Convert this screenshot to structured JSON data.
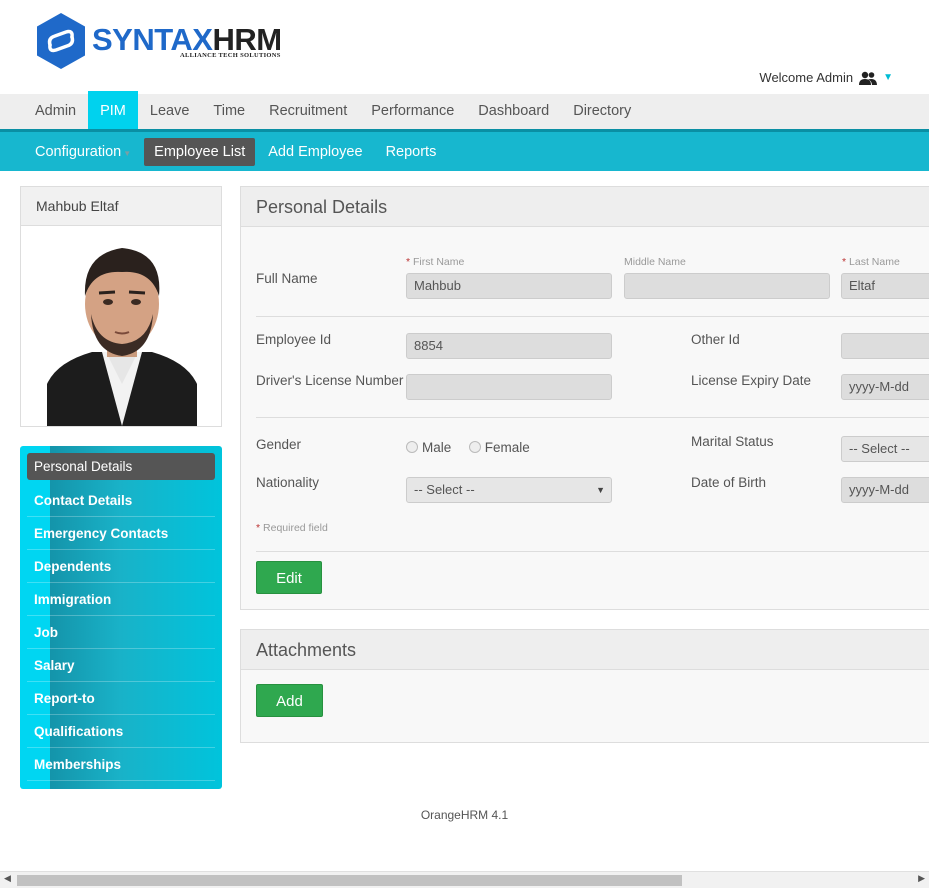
{
  "brand": {
    "syntax": "SYNTAX",
    "hrm": "HRM",
    "tagline": "ALLIANCE TECH SOLUTIONS",
    "hex_color": "#1f69c9"
  },
  "header": {
    "welcome": "Welcome Admin"
  },
  "topnav": [
    "Admin",
    "PIM",
    "Leave",
    "Time",
    "Recruitment",
    "Performance",
    "Dashboard",
    "Directory"
  ],
  "subnav": {
    "configuration": "Configuration",
    "employee_list": "Employee List",
    "add_employee": "Add Employee",
    "reports": "Reports"
  },
  "profile": {
    "name": "Mahbub Eltaf"
  },
  "sidemenu": [
    "Personal Details",
    "Contact Details",
    "Emergency Contacts",
    "Dependents",
    "Immigration",
    "Job",
    "Salary",
    "Report-to",
    "Qualifications",
    "Memberships"
  ],
  "personal": {
    "title": "Personal Details",
    "full_name_label": "Full Name",
    "first_name_label": "First Name",
    "middle_name_label": "Middle Name",
    "last_name_label": "Last Name",
    "req_star": "*",
    "first_name": "Mahbub",
    "middle_name": "",
    "last_name": "Eltaf",
    "employee_id_label": "Employee Id",
    "employee_id": "8854",
    "other_id_label": "Other Id",
    "other_id": "",
    "license_label": "Driver's License Number",
    "license": "",
    "license_expiry_label": "License Expiry Date",
    "license_expiry_placeholder": "yyyy-M-dd",
    "gender_label": "Gender",
    "male": "Male",
    "female": "Female",
    "marital_label": "Marital Status",
    "marital_value": "-- Select --",
    "nationality_label": "Nationality",
    "nationality_value": "-- Select --",
    "dob_label": "Date of Birth",
    "dob_placeholder": "yyyy-M-dd",
    "required_note": "Required field",
    "edit_button": "Edit"
  },
  "attachments": {
    "title": "Attachments",
    "add_button": "Add"
  },
  "footer": {
    "version": "OrangeHRM 4.1"
  },
  "colors": {
    "accent": "#00d2ee",
    "submenu": "#17b7cf",
    "button": "#2fa84f"
  }
}
